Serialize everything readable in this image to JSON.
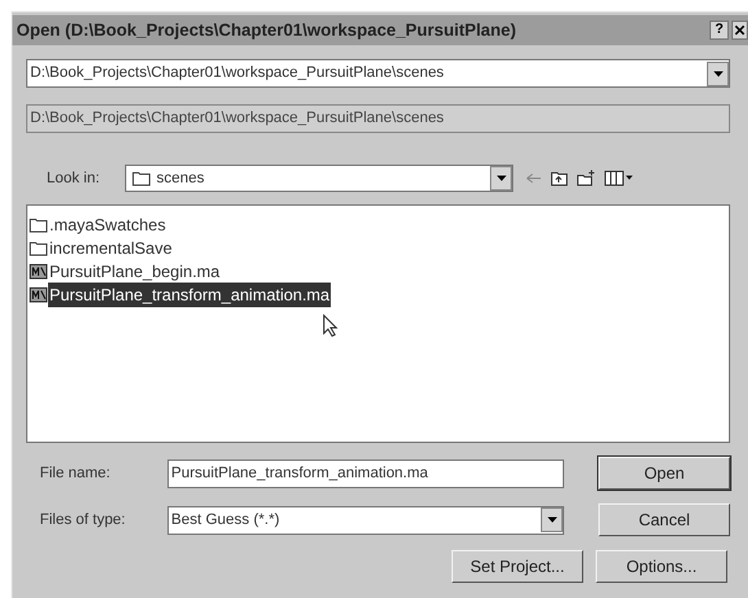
{
  "window": {
    "title": "Open (D:\\Book_Projects\\Chapter01\\workspace_PursuitPlane)",
    "help": "?"
  },
  "path_combo": {
    "value": "D:\\Book_Projects\\Chapter01\\workspace_PursuitPlane\\scenes"
  },
  "path_field": {
    "value": "D:\\Book_Projects\\Chapter01\\workspace_PursuitPlane\\scenes"
  },
  "look_in": {
    "label": "Look in:",
    "value": "scenes"
  },
  "files": [
    {
      "name": ".mayaSwatches",
      "kind": "folder",
      "selected": false
    },
    {
      "name": "incrementalSave",
      "kind": "folder",
      "selected": false
    },
    {
      "name": "PursuitPlane_begin.ma",
      "kind": "scene",
      "selected": false
    },
    {
      "name": "PursuitPlane_transform_animation.ma",
      "kind": "scene",
      "selected": true
    }
  ],
  "file_name": {
    "label": "File name:",
    "value": "PursuitPlane_transform_animation.ma"
  },
  "file_type": {
    "label": "Files of type:",
    "value": "Best Guess (*.*)"
  },
  "buttons": {
    "open": "Open",
    "cancel": "Cancel",
    "set_project": "Set Project...",
    "options": "Options..."
  }
}
